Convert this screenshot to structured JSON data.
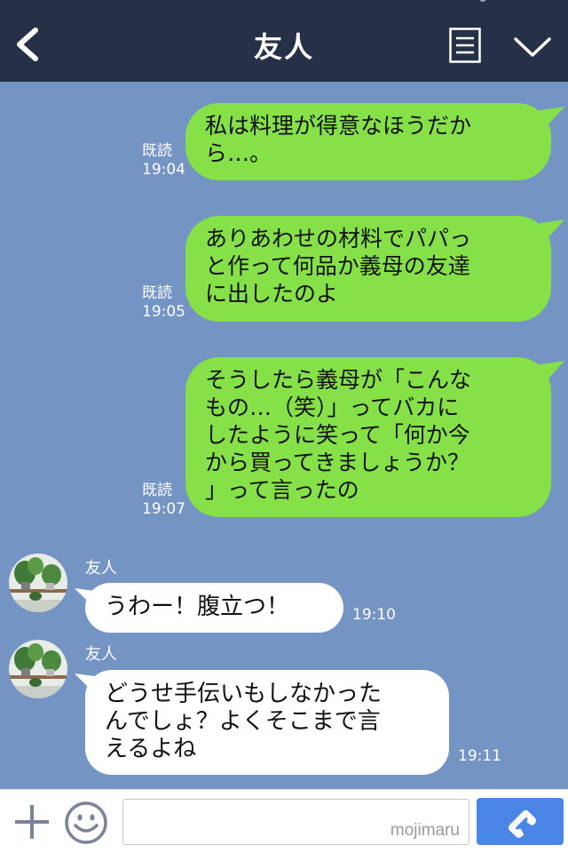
{
  "header": {
    "title": "友人"
  },
  "messages_out": [
    {
      "read": "既読",
      "time": "19:04",
      "lines": [
        "私は料理が得意なほうだか",
        "ら…。"
      ]
    },
    {
      "read": "既読",
      "time": "19:05",
      "lines": [
        "ありあわせの材料でパパっ",
        "と作って何品か義母の友達",
        "に出したのよ"
      ]
    },
    {
      "read": "既読",
      "time": "19:07",
      "lines": [
        "そうしたら義母が「こんな",
        "もの…（笑）」ってバカに",
        "したように笑って「何か今",
        "から買ってきましょうか？",
        "」って言ったの"
      ]
    }
  ],
  "messages_in": [
    {
      "sender": "友人",
      "time": "19:10",
      "lines": [
        "うわー！腹立つ！"
      ]
    },
    {
      "sender": "友人",
      "time": "19:11",
      "lines": [
        "どうせ手伝いもしなかった",
        "んでしょ？よくそこまで言",
        "えるよね"
      ]
    }
  ],
  "footer": {
    "input_value": "",
    "watermark": "mojimaru"
  },
  "colors": {
    "header_bg": "#263147",
    "chat_bg": "#7494c4",
    "bubble_out": "#86e048",
    "bubble_in": "#ffffff",
    "call_button": "#4a86e6"
  },
  "icons": [
    "back-chevron-icon",
    "memo-icon",
    "chevron-down-icon",
    "plus-icon",
    "emoji-icon",
    "phone-icon"
  ]
}
